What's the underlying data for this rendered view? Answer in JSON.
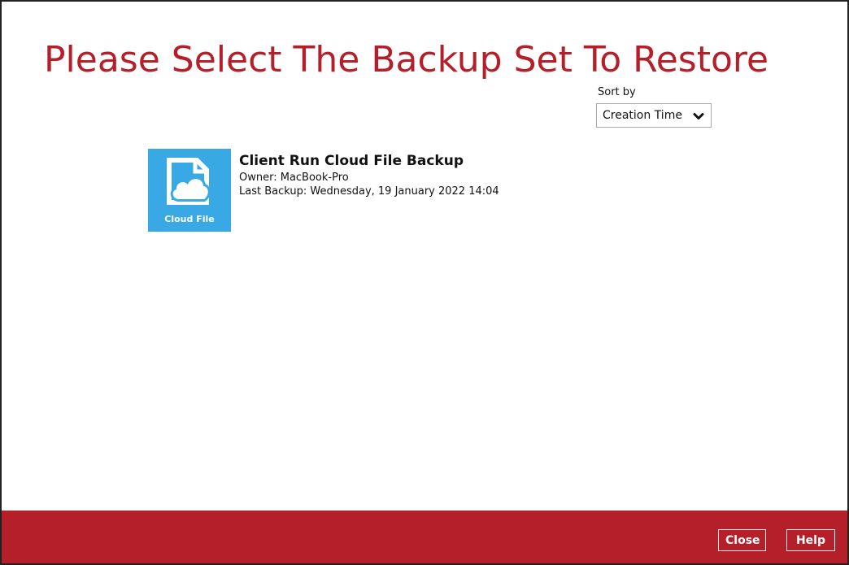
{
  "page": {
    "title": "Please Select The Backup Set To Restore"
  },
  "sort": {
    "label": "Sort by",
    "selected": "Creation Time"
  },
  "backup_sets": [
    {
      "name": "Client Run Cloud File Backup",
      "owner": "Owner: MacBook-Pro",
      "last_backup": "Last Backup: Wednesday, 19 January 2022 14:04",
      "tile_label": "Cloud File",
      "icon": "cloud-file-icon"
    }
  ],
  "footer": {
    "close_label": "Close",
    "help_label": "Help"
  },
  "colors": {
    "accent": "#b51f2a",
    "tile": "#38a9e4"
  }
}
